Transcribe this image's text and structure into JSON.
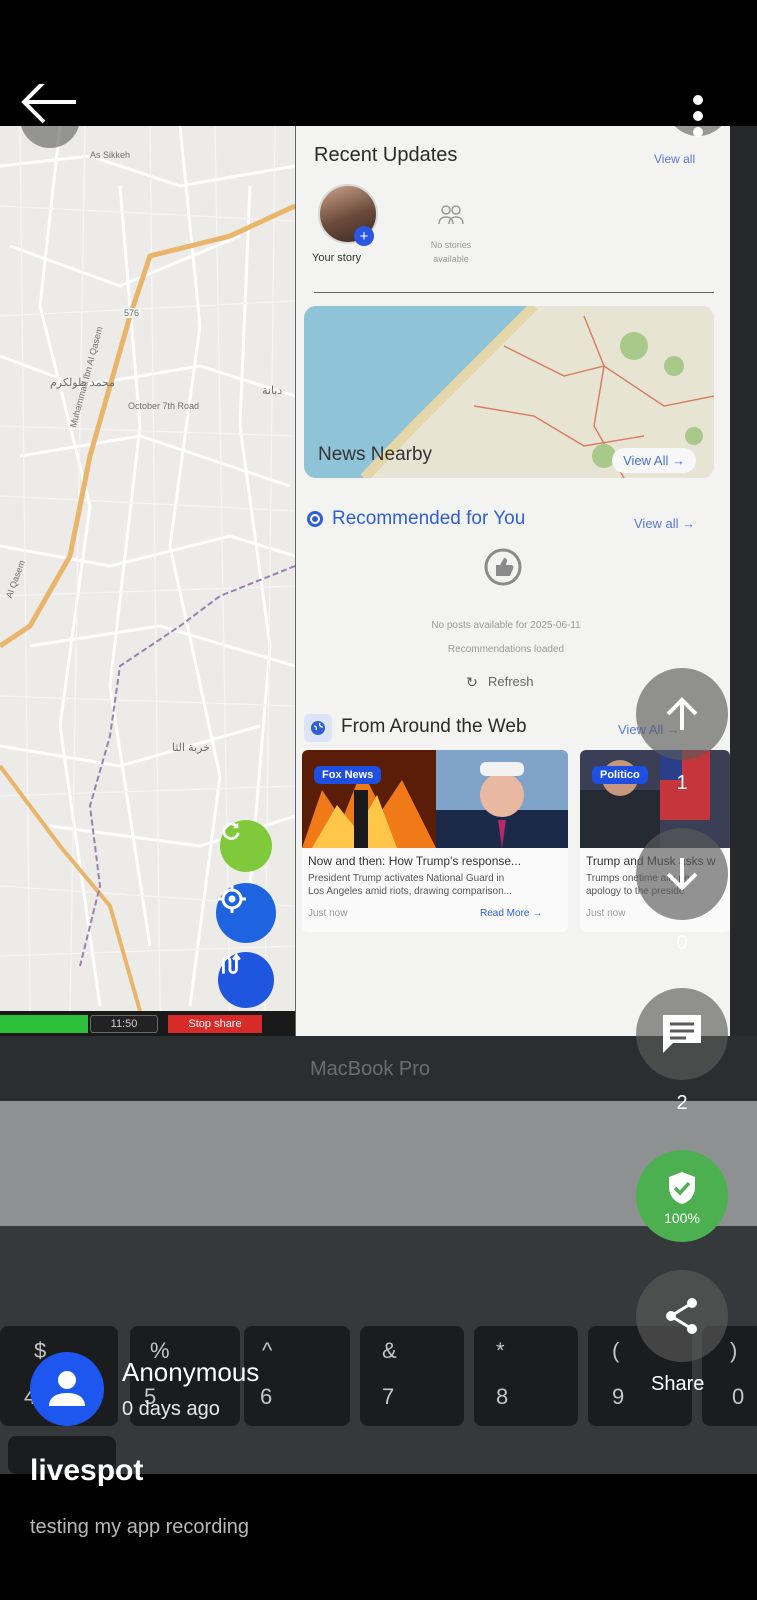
{
  "colors": {
    "accent_blue": "#1e56f0",
    "rank_green": "#4caf50",
    "button_overlay": "#5a5a5a",
    "background": "#000000"
  },
  "top_bar": {
    "back_icon": "arrow-left-icon",
    "menu_icon": "more-vertical-icon"
  },
  "photo": {
    "map": {
      "labels": [
        "As Sikkeh",
        "576",
        "October 7th Road",
        "محمد طولكرم",
        "Muhammad Ibn Al Qasem",
        "Al Qasem",
        "دبانة",
        "خربة الثا"
      ],
      "refresh_icon": "refresh-icon",
      "locate_icon": "crosshair-icon",
      "route_icon": "route-icon",
      "status_time": "11:50",
      "stop_share": "Stop share"
    },
    "panel": {
      "recent_updates_title": "Recent Updates",
      "recent_view_all": "View all",
      "your_story": "Your story",
      "no_stories": "No stories available",
      "news_nearby": "News Nearby",
      "news_view_all": "View All →",
      "recommended_title": "Recommended for You",
      "recommended_view_all": "View all →",
      "no_posts": "No posts available for 2025-06-11",
      "recs_loaded": "Recommendations loaded",
      "refresh": "Refresh",
      "web_title": "From Around the Web",
      "web_view_all": "View All →",
      "cards": [
        {
          "badge": "Fox News",
          "title": "Now and then: How Trump's response...",
          "desc_line1": "President Trump activates National Guard in",
          "desc_line2": "Los Angeles amid riots, drawing comparison...",
          "time": "Just now",
          "read_more": "Read More →"
        },
        {
          "badge": "Politico",
          "title": "Trump and Musk asks w",
          "desc_line1": "Trumps onetime ally pe",
          "desc_line2": "apology to the preside",
          "time": "Just now",
          "read_more": ""
        }
      ]
    },
    "laptop_label": "MacBook Pro",
    "keys": [
      "$",
      "4",
      "%",
      "5",
      "^",
      "6",
      "&",
      "7",
      "*",
      "8",
      "(",
      "9",
      ")",
      "0"
    ]
  },
  "actions": {
    "upvote_count": "1",
    "downvote_count": "0",
    "comment_count": "2",
    "rank_percent": "100%",
    "share_label": "Share"
  },
  "post": {
    "author": "Anonymous",
    "posted": "0 days ago",
    "title": "livespot",
    "description": "testing my app recording"
  }
}
